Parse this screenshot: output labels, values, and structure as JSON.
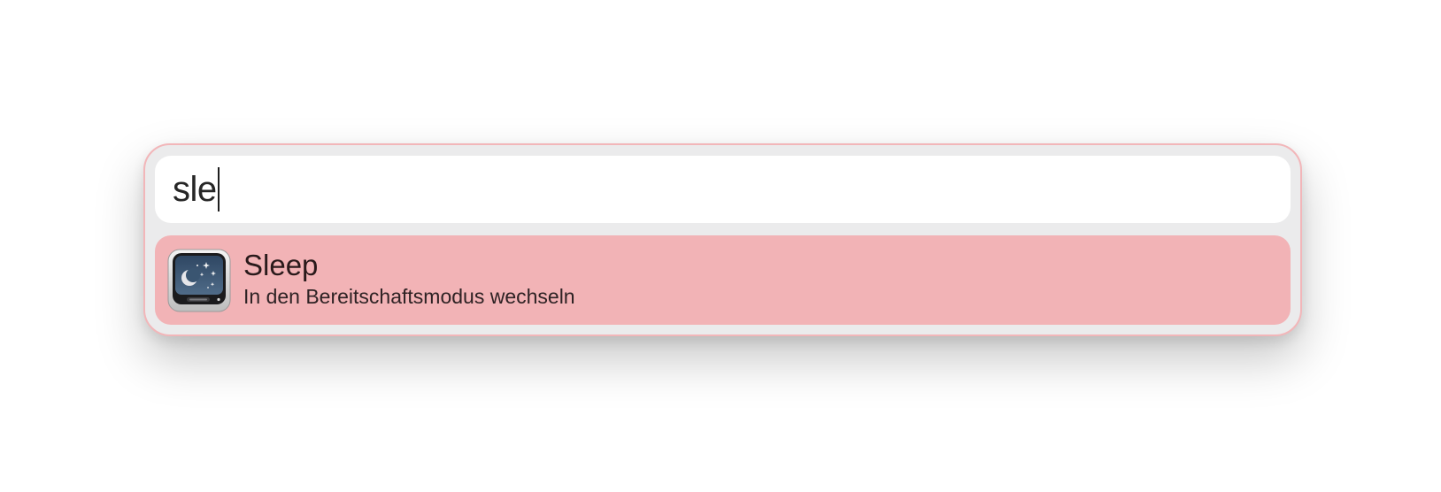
{
  "search": {
    "query": "sle"
  },
  "results": [
    {
      "title": "Sleep",
      "subtitle": "In den Bereitschaftsmodus wechseln",
      "icon": "sleep-monitor-icon",
      "selected": true
    }
  ],
  "colors": {
    "launcher_background": "#ebebec",
    "launcher_border": "#f2b6b9",
    "selected_row": "#f2b3b6",
    "search_background": "#ffffff"
  }
}
